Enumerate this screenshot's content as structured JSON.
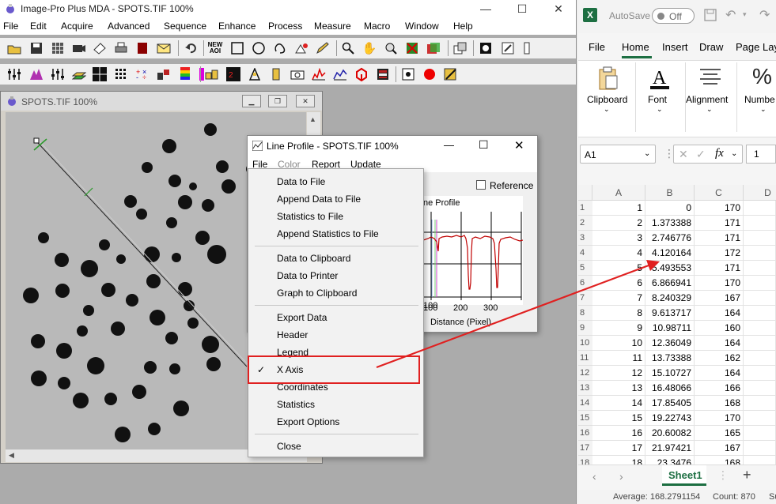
{
  "ipp": {
    "title": "Image-Pro Plus MDA - SPOTS.TIF 100%",
    "menu": [
      "File",
      "Edit",
      "Acquire",
      "Advanced",
      "Sequence",
      "Enhance",
      "Process",
      "Measure",
      "Macro",
      "Window",
      "Help"
    ],
    "new_aoi_label": "NEW\nAOI"
  },
  "spots": {
    "title": "SPOTS.TIF 100%"
  },
  "line_profile": {
    "title": "Line Profile - SPOTS.TIF 100%",
    "menu": [
      "File",
      "Color",
      "Report",
      "Update"
    ],
    "reference_label": "Reference",
    "graph_title": "ne Profile",
    "x_ticks": [
      "100",
      "200",
      "300"
    ],
    "x_label": "Distance (Pixel)"
  },
  "file_menu": {
    "group1": [
      "Data to File",
      "Append Data to File",
      "Statistics to File",
      "Append Statistics to File"
    ],
    "group2": [
      "Data to Clipboard",
      "Data to Printer",
      "Graph to Clipboard"
    ],
    "group3": [
      "Export Data",
      "Header",
      "Legend",
      "X Axis",
      "Coordinates",
      "Statistics",
      "Export Options"
    ],
    "group4": [
      "Close"
    ],
    "checked_item": "X Axis"
  },
  "excel": {
    "autosave_label": "AutoSave",
    "autosave_state": "Off",
    "tabs": [
      "File",
      "Home",
      "Insert",
      "Draw",
      "Page Lay"
    ],
    "active_tab": "Home",
    "ribbon": [
      "Clipboard",
      "Font",
      "Alignment",
      "Numbe"
    ],
    "name_box": "A1",
    "formula_value": "1",
    "columns": [
      "A",
      "B",
      "C",
      "D"
    ],
    "rows": [
      {
        "r": "1",
        "a": "1",
        "b": "0",
        "c": "170"
      },
      {
        "r": "2",
        "a": "2",
        "b": "1.373388",
        "c": "171"
      },
      {
        "r": "3",
        "a": "3",
        "b": "2.746776",
        "c": "171"
      },
      {
        "r": "4",
        "a": "4",
        "b": "4.120164",
        "c": "172"
      },
      {
        "r": "5",
        "a": "5",
        "b": "5.493553",
        "c": "171"
      },
      {
        "r": "6",
        "a": "6",
        "b": "6.866941",
        "c": "170"
      },
      {
        "r": "7",
        "a": "7",
        "b": "8.240329",
        "c": "167"
      },
      {
        "r": "8",
        "a": "8",
        "b": "9.613717",
        "c": "164"
      },
      {
        "r": "9",
        "a": "9",
        "b": "10.98711",
        "c": "160"
      },
      {
        "r": "10",
        "a": "10",
        "b": "12.36049",
        "c": "164"
      },
      {
        "r": "11",
        "a": "11",
        "b": "13.73388",
        "c": "162"
      },
      {
        "r": "12",
        "a": "12",
        "b": "15.10727",
        "c": "164"
      },
      {
        "r": "13",
        "a": "13",
        "b": "16.48066",
        "c": "166"
      },
      {
        "r": "14",
        "a": "14",
        "b": "17.85405",
        "c": "168"
      },
      {
        "r": "15",
        "a": "15",
        "b": "19.22743",
        "c": "170"
      },
      {
        "r": "16",
        "a": "16",
        "b": "20.60082",
        "c": "165"
      },
      {
        "r": "17",
        "a": "17",
        "b": "21.97421",
        "c": "167"
      },
      {
        "r": "18",
        "a": "18",
        "b": "23.3476",
        "c": "168"
      }
    ],
    "sheet_tab": "Sheet1",
    "status_average": "Average: 168.2791154",
    "status_count": "Count: 870",
    "status_sum": "Su"
  },
  "colors": {
    "annotation": "#e02020",
    "excel_green": "#1d6f42",
    "profile_red": "#c00000"
  }
}
